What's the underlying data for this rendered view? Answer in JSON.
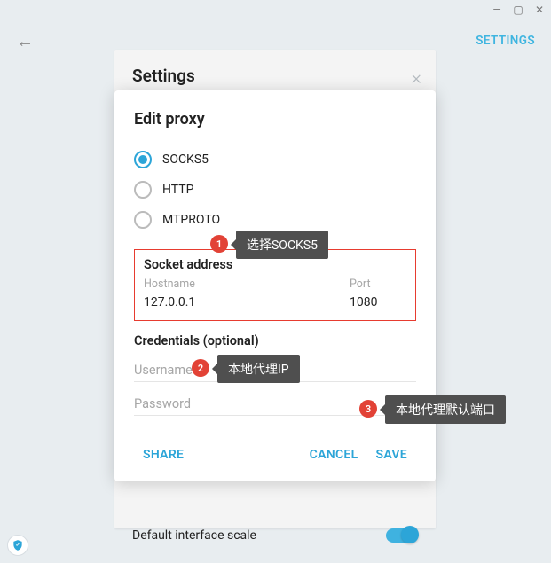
{
  "window": {
    "min": "—",
    "max": "▢",
    "close": "✕"
  },
  "header": {
    "settings": "SETTINGS"
  },
  "underlay": {
    "title": "Settings"
  },
  "modal": {
    "title": "Edit proxy",
    "radios": {
      "socks5": "SOCKS5",
      "http": "HTTP",
      "mtproto": "MTPROTO"
    },
    "socket": {
      "title": "Socket address",
      "hostname_label": "Hostname",
      "hostname_value": "127.0.0.1",
      "port_label": "Port",
      "port_value": "1080"
    },
    "credentials": {
      "title": "Credentials (optional)",
      "username_placeholder": "Username",
      "password_placeholder": "Password"
    },
    "footer": {
      "share": "SHARE",
      "cancel": "CANCEL",
      "save": "SAVE"
    }
  },
  "bottom": {
    "label": "Default interface scale"
  },
  "annotations": {
    "b1": "1",
    "t1": "选择SOCKS5",
    "b2": "2",
    "t2": "本地代理IP",
    "b3": "3",
    "t3": "本地代理默认端口"
  }
}
